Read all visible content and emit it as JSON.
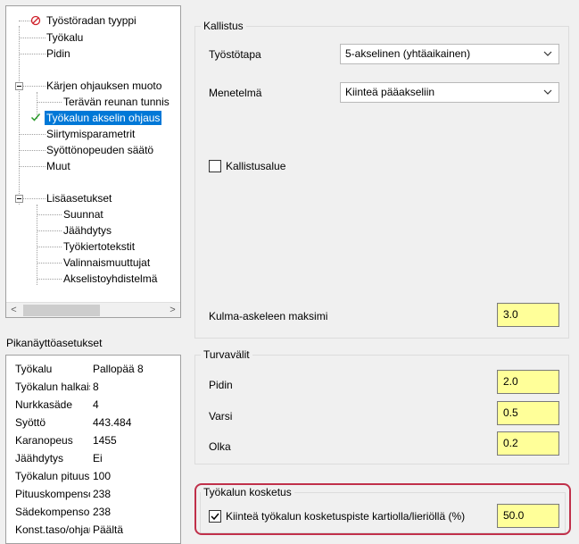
{
  "tree": {
    "items": [
      {
        "label": "Työstöradan tyyppi",
        "status": "error"
      },
      {
        "label": "Työkalu"
      },
      {
        "label": "Pidin"
      },
      {
        "label": "Kärjen ohjauksen muoto",
        "expander": true
      },
      {
        "label": "Terävän reunan tunnis"
      },
      {
        "label": "Työkalun akselin ohjaus",
        "status": "ok",
        "selected": true
      },
      {
        "label": "Siirtymisparametrit"
      },
      {
        "label": "Syöttönopeuden säätö"
      },
      {
        "label": "Muut"
      },
      {
        "label": "Lisäasetukset",
        "expander": true
      },
      {
        "label": "Suunnat"
      },
      {
        "label": "Jäähdytys"
      },
      {
        "label": "Työkiertotekstit"
      },
      {
        "label": "Valinnaismuuttujat"
      },
      {
        "label": "Akselistoyhdistelmä"
      }
    ],
    "scroll_left": "<",
    "scroll_right": ">"
  },
  "quick_settings": {
    "title": "Pikanäyttöasetukset",
    "rows": [
      {
        "key": "Työkalu",
        "value": "Pallopää 8"
      },
      {
        "key": "Työkalun halkaisija",
        "value": "8"
      },
      {
        "key": "Nurkkasäde",
        "value": "4"
      },
      {
        "key": "Syöttö",
        "value": "443.484"
      },
      {
        "key": "Karanopeus",
        "value": "1455"
      },
      {
        "key": "Jäähdytys",
        "value": "Ei"
      },
      {
        "key": "Työkalun pituus",
        "value": "100"
      },
      {
        "key": "Pituuskompensointi",
        "value": "238"
      },
      {
        "key": "Sädekompensointi",
        "value": "238"
      },
      {
        "key": "Konst.taso/ohjaus",
        "value": "Päältä"
      }
    ]
  },
  "tilt": {
    "title": "Kallistus",
    "method_label": "Työstötapa",
    "method_value": "5-akselinen (yhtäaikainen)",
    "approach_label": "Menetelmä",
    "approach_value": "Kiinteä pääakseliin",
    "range_label": "Kallistusalue",
    "range_checked": false,
    "max_angle_label": "Kulma-askeleen maksimi",
    "max_angle_value": "3.0"
  },
  "clearances": {
    "title": "Turvavälit",
    "holder_label": "Pidin",
    "holder_value": "2.0",
    "shank_label": "Varsi",
    "shank_value": "0.5",
    "shoulder_label": "Olka",
    "shoulder_value": "0.2"
  },
  "contact": {
    "title": "Työkalun kosketus",
    "fixed_label": "Kiinteä työkalun kosketuspiste kartiolla/lieriöllä (%)",
    "fixed_checked": true,
    "fixed_value": "50.0"
  },
  "colors": {
    "selection": "#0078d7",
    "input_yellow": "#ffff99",
    "highlight": "#c0304a"
  }
}
